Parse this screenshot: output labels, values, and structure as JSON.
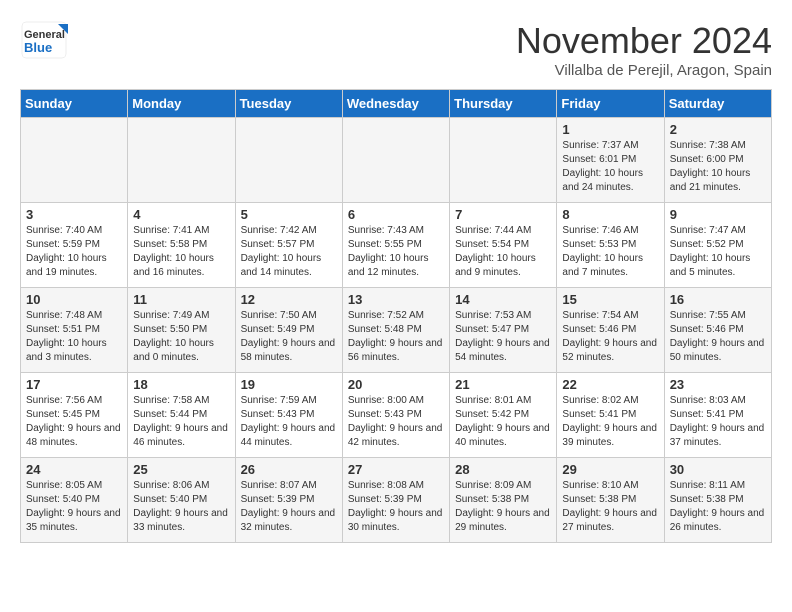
{
  "logo": {
    "line1": "General",
    "line2": "Blue"
  },
  "title": "November 2024",
  "subtitle": "Villalba de Perejil, Aragon, Spain",
  "weekdays": [
    "Sunday",
    "Monday",
    "Tuesday",
    "Wednesday",
    "Thursday",
    "Friday",
    "Saturday"
  ],
  "weeks": [
    [
      {
        "day": "",
        "info": ""
      },
      {
        "day": "",
        "info": ""
      },
      {
        "day": "",
        "info": ""
      },
      {
        "day": "",
        "info": ""
      },
      {
        "day": "",
        "info": ""
      },
      {
        "day": "1",
        "info": "Sunrise: 7:37 AM\nSunset: 6:01 PM\nDaylight: 10 hours and 24 minutes."
      },
      {
        "day": "2",
        "info": "Sunrise: 7:38 AM\nSunset: 6:00 PM\nDaylight: 10 hours and 21 minutes."
      }
    ],
    [
      {
        "day": "3",
        "info": "Sunrise: 7:40 AM\nSunset: 5:59 PM\nDaylight: 10 hours and 19 minutes."
      },
      {
        "day": "4",
        "info": "Sunrise: 7:41 AM\nSunset: 5:58 PM\nDaylight: 10 hours and 16 minutes."
      },
      {
        "day": "5",
        "info": "Sunrise: 7:42 AM\nSunset: 5:57 PM\nDaylight: 10 hours and 14 minutes."
      },
      {
        "day": "6",
        "info": "Sunrise: 7:43 AM\nSunset: 5:55 PM\nDaylight: 10 hours and 12 minutes."
      },
      {
        "day": "7",
        "info": "Sunrise: 7:44 AM\nSunset: 5:54 PM\nDaylight: 10 hours and 9 minutes."
      },
      {
        "day": "8",
        "info": "Sunrise: 7:46 AM\nSunset: 5:53 PM\nDaylight: 10 hours and 7 minutes."
      },
      {
        "day": "9",
        "info": "Sunrise: 7:47 AM\nSunset: 5:52 PM\nDaylight: 10 hours and 5 minutes."
      }
    ],
    [
      {
        "day": "10",
        "info": "Sunrise: 7:48 AM\nSunset: 5:51 PM\nDaylight: 10 hours and 3 minutes."
      },
      {
        "day": "11",
        "info": "Sunrise: 7:49 AM\nSunset: 5:50 PM\nDaylight: 10 hours and 0 minutes."
      },
      {
        "day": "12",
        "info": "Sunrise: 7:50 AM\nSunset: 5:49 PM\nDaylight: 9 hours and 58 minutes."
      },
      {
        "day": "13",
        "info": "Sunrise: 7:52 AM\nSunset: 5:48 PM\nDaylight: 9 hours and 56 minutes."
      },
      {
        "day": "14",
        "info": "Sunrise: 7:53 AM\nSunset: 5:47 PM\nDaylight: 9 hours and 54 minutes."
      },
      {
        "day": "15",
        "info": "Sunrise: 7:54 AM\nSunset: 5:46 PM\nDaylight: 9 hours and 52 minutes."
      },
      {
        "day": "16",
        "info": "Sunrise: 7:55 AM\nSunset: 5:46 PM\nDaylight: 9 hours and 50 minutes."
      }
    ],
    [
      {
        "day": "17",
        "info": "Sunrise: 7:56 AM\nSunset: 5:45 PM\nDaylight: 9 hours and 48 minutes."
      },
      {
        "day": "18",
        "info": "Sunrise: 7:58 AM\nSunset: 5:44 PM\nDaylight: 9 hours and 46 minutes."
      },
      {
        "day": "19",
        "info": "Sunrise: 7:59 AM\nSunset: 5:43 PM\nDaylight: 9 hours and 44 minutes."
      },
      {
        "day": "20",
        "info": "Sunrise: 8:00 AM\nSunset: 5:43 PM\nDaylight: 9 hours and 42 minutes."
      },
      {
        "day": "21",
        "info": "Sunrise: 8:01 AM\nSunset: 5:42 PM\nDaylight: 9 hours and 40 minutes."
      },
      {
        "day": "22",
        "info": "Sunrise: 8:02 AM\nSunset: 5:41 PM\nDaylight: 9 hours and 39 minutes."
      },
      {
        "day": "23",
        "info": "Sunrise: 8:03 AM\nSunset: 5:41 PM\nDaylight: 9 hours and 37 minutes."
      }
    ],
    [
      {
        "day": "24",
        "info": "Sunrise: 8:05 AM\nSunset: 5:40 PM\nDaylight: 9 hours and 35 minutes."
      },
      {
        "day": "25",
        "info": "Sunrise: 8:06 AM\nSunset: 5:40 PM\nDaylight: 9 hours and 33 minutes."
      },
      {
        "day": "26",
        "info": "Sunrise: 8:07 AM\nSunset: 5:39 PM\nDaylight: 9 hours and 32 minutes."
      },
      {
        "day": "27",
        "info": "Sunrise: 8:08 AM\nSunset: 5:39 PM\nDaylight: 9 hours and 30 minutes."
      },
      {
        "day": "28",
        "info": "Sunrise: 8:09 AM\nSunset: 5:38 PM\nDaylight: 9 hours and 29 minutes."
      },
      {
        "day": "29",
        "info": "Sunrise: 8:10 AM\nSunset: 5:38 PM\nDaylight: 9 hours and 27 minutes."
      },
      {
        "day": "30",
        "info": "Sunrise: 8:11 AM\nSunset: 5:38 PM\nDaylight: 9 hours and 26 minutes."
      }
    ]
  ]
}
